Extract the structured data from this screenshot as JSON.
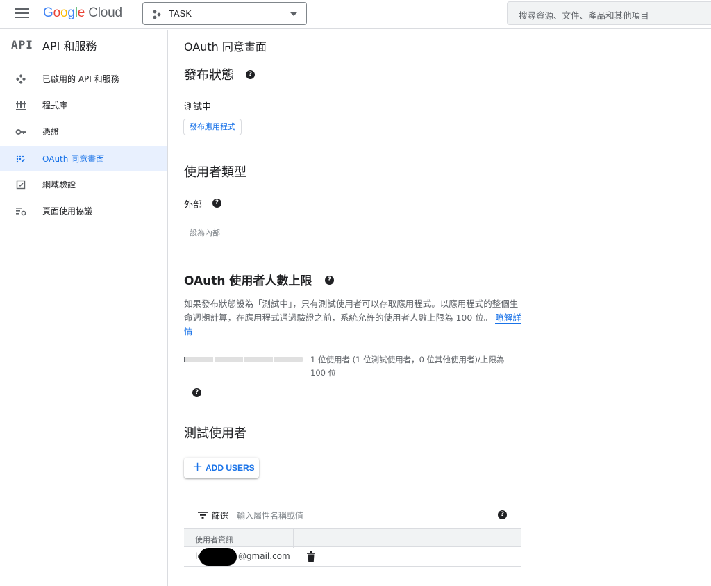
{
  "topbar": {
    "logo_google": [
      "G",
      "o",
      "o",
      "g",
      "l",
      "e"
    ],
    "logo_cloud": "Cloud",
    "project_name": "TASK",
    "search_placeholder": "搜尋資源、文件、產品和其他項目"
  },
  "sidebar": {
    "api_logo": "API",
    "title": "API 和服務",
    "items": [
      {
        "label": "已啟用的 API 和服務",
        "icon": "api-services-icon",
        "active": false
      },
      {
        "label": "程式庫",
        "icon": "library-icon",
        "active": false
      },
      {
        "label": "憑證",
        "icon": "key-icon",
        "active": false
      },
      {
        "label": "OAuth 同意畫面",
        "icon": "oauth-consent-icon",
        "active": true
      },
      {
        "label": "網域驗證",
        "icon": "domain-verification-icon",
        "active": false
      },
      {
        "label": "頁面使用協議",
        "icon": "page-usage-icon",
        "active": false
      }
    ]
  },
  "main": {
    "page_title": "OAuth 同意畫面",
    "publish_status": {
      "heading": "發布狀態",
      "status": "測試中",
      "button": "發布應用程式"
    },
    "user_type": {
      "heading": "使用者類型",
      "value": "外部",
      "button": "設為內部"
    },
    "user_cap": {
      "heading": "OAuth 使用者人數上限",
      "description": "如果發布狀態設為「測試中」，只有測試使用者可以存取應用程式。以應用程式的整個生命週期計算，在應用程式通過驗證之前，系統允許的使用者人數上限為 100 位。",
      "learn_more": "瞭解詳情",
      "progress_text": "1 位使用者 (1 位測試使用者，0 位其他使用者)/上限為 100 位",
      "progress_fraction": 0.01
    },
    "test_users": {
      "heading": "測試使用者",
      "add_button": "ADD USERS",
      "filter_label": "篩選",
      "filter_placeholder": "輸入屬性名稱或值",
      "column_header": "使用者資訊",
      "rows": [
        {
          "email_prefix": "lc",
          "email_suffix": "@gmail.com"
        }
      ]
    }
  },
  "colors": {
    "accent": "#1a73e8",
    "active_bg": "#e8f0fe",
    "border": "#dadce0"
  }
}
